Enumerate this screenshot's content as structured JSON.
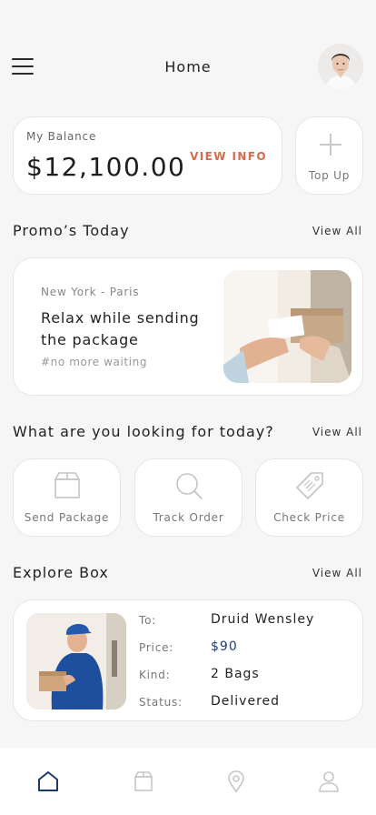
{
  "header": {
    "title": "Home"
  },
  "balance": {
    "label": "My Balance",
    "amount": "$12,100.00",
    "view_info": "VIEW INFO"
  },
  "top_up": {
    "label": "Top Up"
  },
  "promos": {
    "title": "Promo’s Today",
    "view_all": "View All",
    "card": {
      "route": "New York - Paris",
      "headline": "Relax while sending the package",
      "tag": "#no more waiting"
    }
  },
  "services": {
    "title": "What are you looking for today?",
    "view_all": "View All",
    "items": [
      {
        "label": "Send Package",
        "icon": "package-icon"
      },
      {
        "label": "Track Order",
        "icon": "search-icon"
      },
      {
        "label": "Check Price",
        "icon": "price-tag-icon"
      }
    ]
  },
  "explore": {
    "title": "Explore Box",
    "view_all": "View All",
    "box": {
      "to_label": "To:",
      "to": "Druid Wensley",
      "price_label": "Price:",
      "price": "$90",
      "kind_label": "Kind:",
      "kind": "2 Bags",
      "status_label": "Status:",
      "status": "Delivered"
    }
  },
  "bottom_nav": {
    "items": [
      {
        "icon": "home-icon",
        "active": true
      },
      {
        "icon": "box-icon",
        "active": false
      },
      {
        "icon": "location-pin-icon",
        "active": false
      },
      {
        "icon": "profile-icon",
        "active": false
      }
    ]
  },
  "colors": {
    "accent": "#d66a4a",
    "price": "#1e3d7a",
    "active_nav": "#1d3b6a",
    "inactive_nav": "#c6c6c6"
  }
}
